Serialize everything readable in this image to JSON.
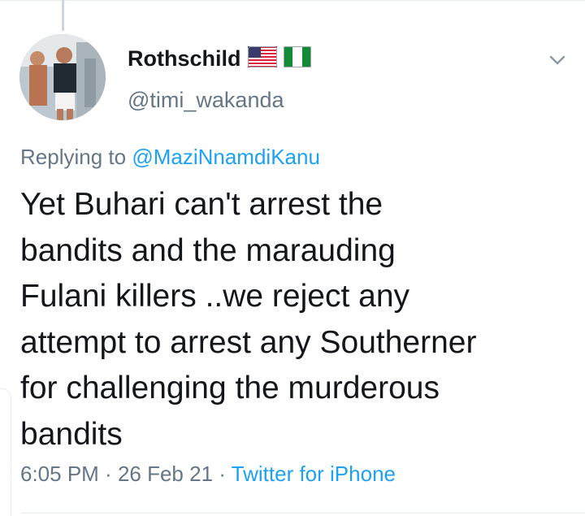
{
  "tweet": {
    "display_name": "Rothschild",
    "handle": "@timi_wakanda",
    "flags": [
      "us-flag-icon",
      "nigeria-flag-icon"
    ],
    "replying_prefix": "Replying to",
    "replying_to": "@MaziNnamdiKanu",
    "text_lines": [
      "Yet Buhari can't arrest the",
      "bandits and the marauding",
      "Fulani killers ..we reject any",
      "attempt to arrest any Southerner",
      "for challenging the murderous",
      "bandits"
    ],
    "time": "6:05 PM",
    "separator": " · ",
    "date": "26 Feb 21",
    "source": "Twitter for iPhone"
  },
  "colors": {
    "accent": "#1da1f2",
    "secondary_text": "#657786",
    "primary_text": "#14171a",
    "divider": "#e6ecf0"
  },
  "icons": {
    "menu": "chevron-down-icon"
  }
}
